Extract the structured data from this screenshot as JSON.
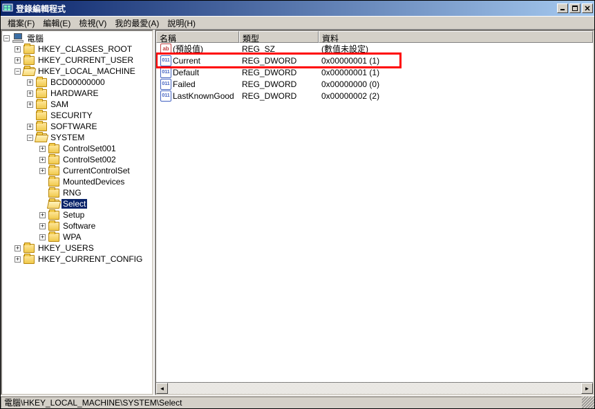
{
  "window": {
    "title": "登錄編輯程式"
  },
  "menu": {
    "file": "檔案(F)",
    "edit": "編輯(E)",
    "view": "檢視(V)",
    "favorites": "我的最愛(A)",
    "help": "說明(H)"
  },
  "tree": {
    "root": "電腦",
    "hkcr": "HKEY_CLASSES_ROOT",
    "hkcu": "HKEY_CURRENT_USER",
    "hklm": "HKEY_LOCAL_MACHINE",
    "bcd": "BCD00000000",
    "hardware": "HARDWARE",
    "sam": "SAM",
    "security": "SECURITY",
    "software": "SOFTWARE",
    "system": "SYSTEM",
    "cs001": "ControlSet001",
    "cs002": "ControlSet002",
    "ccs": "CurrentControlSet",
    "mounted": "MountedDevices",
    "rng": "RNG",
    "select": "Select",
    "setup": "Setup",
    "software2": "Software",
    "wpa": "WPA",
    "hku": "HKEY_USERS",
    "hkcc": "HKEY_CURRENT_CONFIG"
  },
  "columns": {
    "name": "名稱",
    "type": "類型",
    "data": "資料"
  },
  "values": [
    {
      "icon": "str",
      "name": "(預設值)",
      "type": "REG_SZ",
      "data": "(數值未設定)"
    },
    {
      "icon": "dw",
      "name": "Current",
      "type": "REG_DWORD",
      "data": "0x00000001 (1)"
    },
    {
      "icon": "dw",
      "name": "Default",
      "type": "REG_DWORD",
      "data": "0x00000001 (1)"
    },
    {
      "icon": "dw",
      "name": "Failed",
      "type": "REG_DWORD",
      "data": "0x00000000 (0)"
    },
    {
      "icon": "dw",
      "name": "LastKnownGood",
      "type": "REG_DWORD",
      "data": "0x00000002 (2)"
    }
  ],
  "status": {
    "path": "電腦\\HKEY_LOCAL_MACHINE\\SYSTEM\\Select"
  },
  "icon_labels": {
    "str": "ab",
    "dw": "011\n110"
  }
}
